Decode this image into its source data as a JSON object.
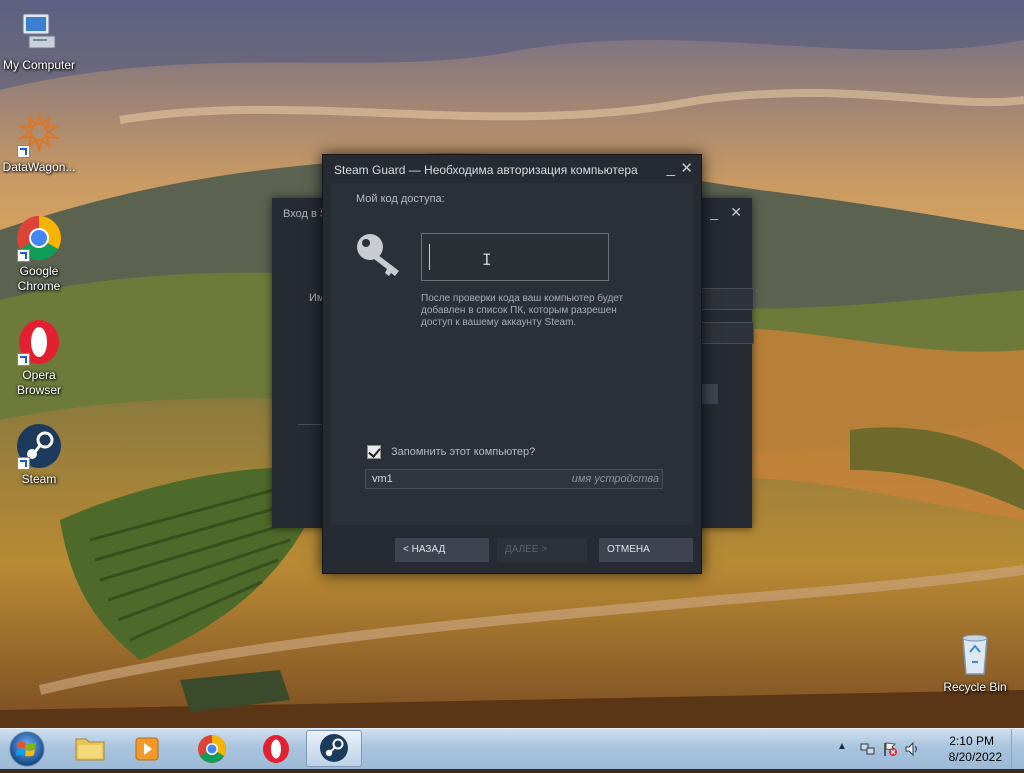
{
  "desktop": {
    "icons": [
      {
        "label": "My Computer"
      },
      {
        "label": "DataWagon..."
      },
      {
        "label": "Google Chrome"
      },
      {
        "label": "Opera Browser"
      },
      {
        "label": "Steam"
      },
      {
        "label": "Recycle Bin"
      }
    ]
  },
  "login_window": {
    "title": "Вход в S",
    "field_label": "Им"
  },
  "guard_dialog": {
    "title": "Steam Guard — Необходима авторизация компьютера",
    "code_label": "Мой код доступа:",
    "code_value": "",
    "info_text": "После проверки кода ваш компьютер будет добавлен в список ПК, которым разрешен доступ к вашему аккаунту Steam.",
    "remember_label": "Запомнить этот компьютер?",
    "remember_checked": true,
    "device_name_value": "vm1",
    "device_name_placeholder": "имя устройства",
    "buttons": {
      "back": "< НАЗАД",
      "next": "ДАЛЕЕ >",
      "cancel": "ОТМЕНА"
    },
    "controls": {
      "minimize": "_",
      "close": "✕"
    }
  },
  "taskbar": {
    "apps": [
      "explorer",
      "media-player",
      "google-chrome",
      "opera",
      "steam"
    ],
    "active_app": "steam",
    "clock": {
      "time": "2:10 PM",
      "date": "8/20/2022"
    },
    "tray_icons": [
      "show-hidden-icons",
      "network-icon",
      "action-center-flag-icon",
      "volume-icon"
    ]
  },
  "colors": {
    "dialog_bg": "#262a32",
    "button_bg": "#3d4450",
    "taskbar": "#a9c4de"
  }
}
